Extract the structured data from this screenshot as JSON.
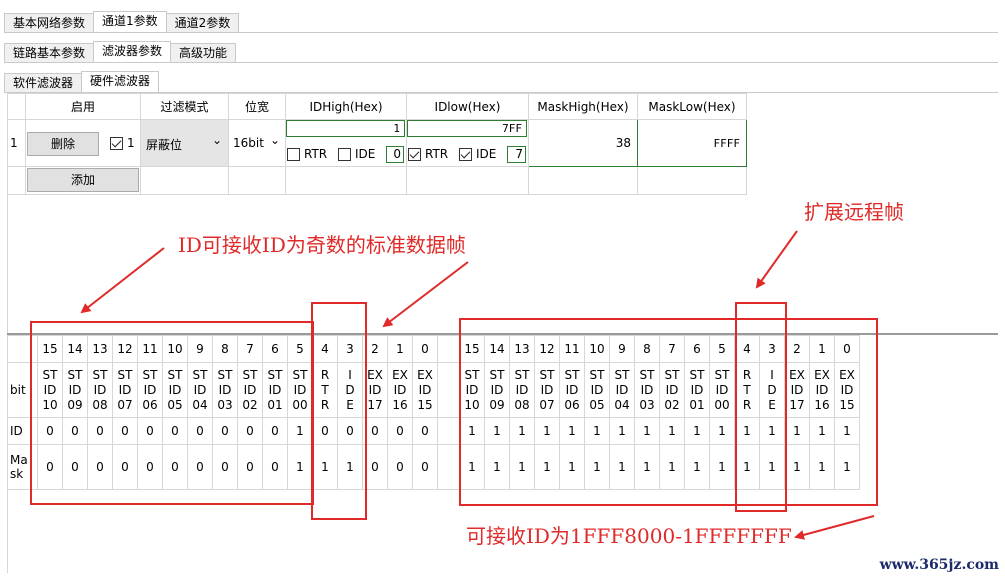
{
  "top_tabs": [
    "基本网络参数",
    "通道1参数",
    "通道2参数"
  ],
  "top_active": 1,
  "sub_tabs": [
    "链路基本参数",
    "滤波器参数",
    "高级功能"
  ],
  "sub_active": 1,
  "filter_tabs": [
    "软件滤波器",
    "硬件滤波器"
  ],
  "filter_active": 1,
  "grid": {
    "headers": [
      "启用",
      "过滤模式",
      "位宽",
      "IDHigh(Hex)",
      "IDlow(Hex)",
      "MaskHigh(Hex)",
      "MaskLow(Hex)"
    ],
    "row_index": "1",
    "delete_label": "删除",
    "enable_num": "1",
    "mode": "屏蔽位",
    "width": "16bit",
    "id_high": "1",
    "id_low": "7FF",
    "rtr_label": "RTR",
    "ide_label": "IDE",
    "high_num": "0",
    "low_num": "7",
    "mask_high": "38",
    "mask_low": "FFFF",
    "add_label": "添加"
  },
  "bits": {
    "row_labels": {
      "bit": "bit",
      "id": "ID",
      "mask": "Ma\nsk"
    },
    "left": {
      "numbers": [
        "15",
        "14",
        "13",
        "12",
        "11",
        "10",
        "9",
        "8",
        "7",
        "6",
        "5",
        "4",
        "3",
        "2",
        "1",
        "0"
      ],
      "names": [
        "ST\nID\n10",
        "ST\nID\n09",
        "ST\nID\n08",
        "ST\nID\n07",
        "ST\nID\n06",
        "ST\nID\n05",
        "ST\nID\n04",
        "ST\nID\n03",
        "ST\nID\n02",
        "ST\nID\n01",
        "ST\nID\n00",
        "R\nT\nR",
        "I\nD\nE",
        "EX\nID\n17",
        "EX\nID\n16",
        "EX\nID\n15"
      ],
      "id": [
        "0",
        "0",
        "0",
        "0",
        "0",
        "0",
        "0",
        "0",
        "0",
        "0",
        "1",
        "0",
        "0",
        "0",
        "0",
        "0"
      ],
      "mask": [
        "0",
        "0",
        "0",
        "0",
        "0",
        "0",
        "0",
        "0",
        "0",
        "0",
        "1",
        "1",
        "1",
        "0",
        "0",
        "0"
      ]
    },
    "right": {
      "numbers": [
        "15",
        "14",
        "13",
        "12",
        "11",
        "10",
        "9",
        "8",
        "7",
        "6",
        "5",
        "4",
        "3",
        "2",
        "1",
        "0"
      ],
      "names": [
        "ST\nID\n10",
        "ST\nID\n09",
        "ST\nID\n08",
        "ST\nID\n07",
        "ST\nID\n06",
        "ST\nID\n05",
        "ST\nID\n04",
        "ST\nID\n03",
        "ST\nID\n02",
        "ST\nID\n01",
        "ST\nID\n00",
        "R\nT\nR",
        "I\nD\nE",
        "EX\nID\n17",
        "EX\nID\n16",
        "EX\nID\n15"
      ],
      "id": [
        "1",
        "1",
        "1",
        "1",
        "1",
        "1",
        "1",
        "1",
        "1",
        "1",
        "1",
        "1",
        "1",
        "1",
        "1",
        "1"
      ],
      "mask": [
        "1",
        "1",
        "1",
        "1",
        "1",
        "1",
        "1",
        "1",
        "1",
        "1",
        "1",
        "1",
        "1",
        "1",
        "1",
        "1"
      ]
    }
  },
  "annotations": {
    "left": "ID可接收ID为奇数的标准数据帧",
    "right": "扩展远程帧",
    "bottom": "可接收ID为1FFF8000-1FFFFFFF"
  },
  "watermark": "www.365jz.com",
  "colors": {
    "annotation": "#e02a2a",
    "field_border": "#2e7d32"
  }
}
